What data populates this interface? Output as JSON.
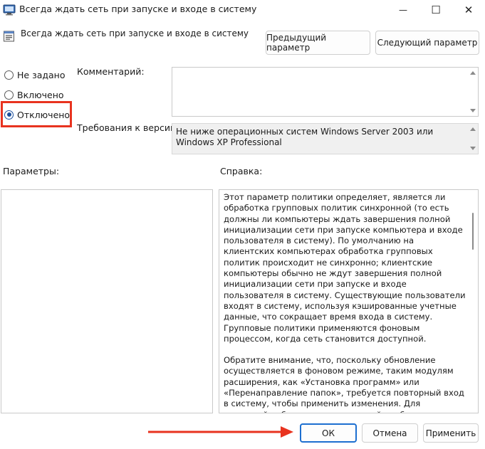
{
  "window": {
    "title": "Всегда ждать сеть при запуске и входе в систему",
    "minimize_glyph": "—",
    "maximize_glyph": "☐",
    "close_glyph": "✕"
  },
  "header": {
    "policy_name": "Всегда ждать сеть при запуске и входе в систему",
    "prev_button": "Предыдущий параметр",
    "next_button": "Следующий параметр"
  },
  "state": {
    "options": [
      {
        "label": "Не задано",
        "checked": false
      },
      {
        "label": "Включено",
        "checked": false
      },
      {
        "label": "Отключено",
        "checked": true
      }
    ]
  },
  "comment": {
    "label": "Комментарий:",
    "value": ""
  },
  "supported": {
    "label": "Требования к версии:",
    "value": "Не ниже операционных систем Windows Server 2003 или Windows XP Professional"
  },
  "options_panel": {
    "label": "Параметры:"
  },
  "help_panel": {
    "label": "Справка:",
    "paragraphs": [
      "Этот параметр политики определяет, является ли обработка групповых политик синхронной (то есть должны ли компьютеры ждать завершения полной инициализации сети при запуске компьютера и входе пользователя в систему). По умолчанию на клиентских компьютерах обработка групповых политик происходит не синхронно; клиентские компьютеры обычно не ждут завершения полной инициализации сети при запуске и входе пользователя в систему. Существующие пользователи входят в систему, используя кэшированные учетные данные, что сокращает время входа в систему. Групповые политики применяются фоновым процессом, когда сеть становится доступной.",
      "Обратите внимание, что, поскольку обновление осуществляется в фоновом режиме, таким модулям расширения, как «Установка программ» или «Перенаправление папок», требуется повторный вход в систему, чтобы применить изменения. Для надежной работы этих расширений необходимо отсутствие в системе зарегистрированных пользователей. Следовательно, они должны быть отработаны как основные до начала активного"
    ]
  },
  "footer": {
    "ok_button": "ОК",
    "cancel_button": "Отмена",
    "apply_button": "Применить"
  },
  "annotation": {
    "highlight_color": "#e8331f",
    "arrow_color": "#e8331f"
  },
  "colors": {
    "accent": "#1d6fd0",
    "radio_checked": "#1b4f9c"
  }
}
